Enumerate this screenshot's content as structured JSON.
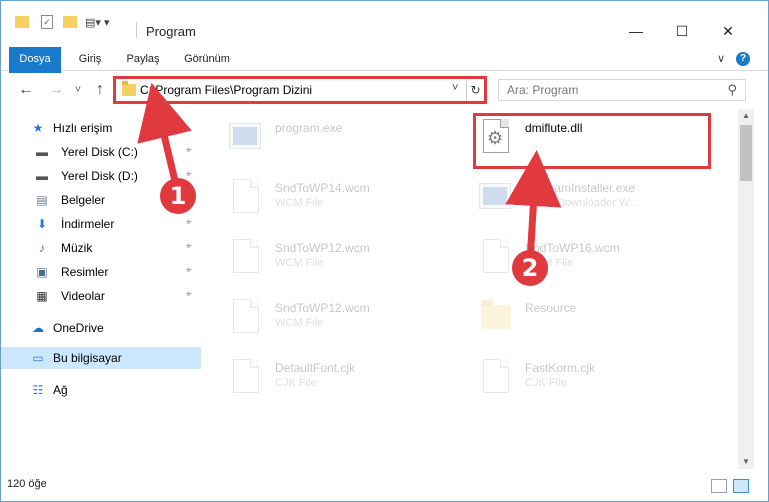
{
  "window": {
    "title": "Program",
    "controls": {
      "minimize": "—",
      "maximize": "☐",
      "close": "✕"
    }
  },
  "ribbon": {
    "tabs": [
      "Dosya",
      "Giriş",
      "Paylaş",
      "Görünüm"
    ],
    "collapse_glyph": "∨",
    "help_glyph": "?"
  },
  "nav": {
    "back_glyph": "←",
    "forward_glyph": "→",
    "recent_glyph": "˅",
    "up_glyph": "↑",
    "address": "C:\\Program Files\\Program Dizini",
    "address_dropdown_glyph": "˅",
    "refresh_glyph": "↻",
    "search_placeholder": "Ara: Program",
    "search_glyph": "⚲"
  },
  "sidebar": {
    "items": [
      {
        "label": "Hızlı erişim",
        "icon": "star-icon",
        "glyph": "★",
        "color": "#2b79d0",
        "pinned": false,
        "selected": false
      },
      {
        "label": "Yerel Disk (C:)",
        "icon": "drive-icon",
        "glyph": "▬",
        "color": "#555555",
        "pinned": true,
        "selected": false
      },
      {
        "label": "Yerel Disk (D:)",
        "icon": "drive-icon",
        "glyph": "▬",
        "color": "#555555",
        "pinned": true,
        "selected": false
      },
      {
        "label": "Belgeler",
        "icon": "documents-icon",
        "glyph": "▤",
        "color": "#6a7b8c",
        "pinned": true,
        "selected": false
      },
      {
        "label": "İndirmeler",
        "icon": "download-icon",
        "glyph": "⬇",
        "color": "#2b79d0",
        "pinned": true,
        "selected": false
      },
      {
        "label": "Müzik",
        "icon": "music-icon",
        "glyph": "♪",
        "color": "#2b79d0",
        "pinned": true,
        "selected": false
      },
      {
        "label": "Resimler",
        "icon": "pictures-icon",
        "glyph": "▣",
        "color": "#4b6d8f",
        "pinned": true,
        "selected": false
      },
      {
        "label": "Videolar",
        "icon": "videos-icon",
        "glyph": "▦",
        "color": "#333333",
        "pinned": true,
        "selected": false
      },
      {
        "label": "OneDrive",
        "icon": "cloud-icon",
        "glyph": "☁",
        "color": "#1e6fc7",
        "pinned": false,
        "selected": false
      },
      {
        "label": "Bu bilgisayar",
        "icon": "computer-icon",
        "glyph": "▭",
        "color": "#2b79d0",
        "pinned": false,
        "selected": true
      },
      {
        "label": "Ağ",
        "icon": "network-icon",
        "glyph": "☷",
        "color": "#2b79d0",
        "pinned": false,
        "selected": false
      }
    ],
    "pin_glyph": "⌖"
  },
  "files": [
    {
      "name": "program.exe",
      "type": "",
      "icon": "installer-icon",
      "faded": true,
      "col": 0,
      "row": 0
    },
    {
      "name": "dmiflute.dll",
      "type": "",
      "icon": "dll-gear-icon",
      "faded": false,
      "col": 1,
      "row": 0
    },
    {
      "name": "SndToWP14.wcm",
      "type": "WCM File",
      "icon": "file-icon",
      "faded": true,
      "col": 0,
      "row": 1
    },
    {
      "name": "ProgramInstaller.exe",
      "type": "SSEY Downloader W...",
      "icon": "exe-icon",
      "faded": true,
      "col": 1,
      "row": 1
    },
    {
      "name": "SndToWP12.wcm",
      "type": "WCM File",
      "icon": "file-icon",
      "faded": true,
      "col": 0,
      "row": 2
    },
    {
      "name": "SndToWP16.wcm",
      "type": "WCM File",
      "icon": "file-icon",
      "faded": true,
      "col": 1,
      "row": 2
    },
    {
      "name": "SndToWP12.wcm",
      "type": "WCM File",
      "icon": "file-icon",
      "faded": true,
      "col": 0,
      "row": 3
    },
    {
      "name": "Resource",
      "type": "",
      "icon": "folder-icon",
      "faded": true,
      "col": 1,
      "row": 3
    },
    {
      "name": "DefaultFont.cjk",
      "type": "CJK File",
      "icon": "file-icon",
      "faded": true,
      "col": 0,
      "row": 4
    },
    {
      "name": "FastKorm.cjk",
      "type": "CJK File",
      "icon": "file-icon",
      "faded": true,
      "col": 1,
      "row": 4
    }
  ],
  "status": {
    "count": "120 öğe"
  },
  "annotations": {
    "step1": "1",
    "step2": "2",
    "color": "#e0393e"
  }
}
